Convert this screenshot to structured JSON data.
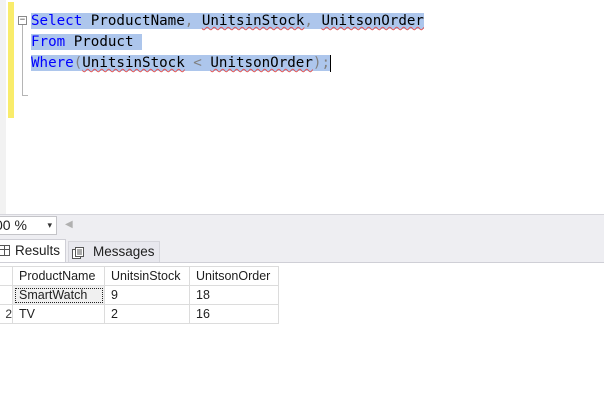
{
  "editor": {
    "lines": {
      "line1": {
        "kw_select": "Select",
        "sp1": " ",
        "col1": "ProductName",
        "comma1": ",",
        "sp2": " ",
        "col2": "UnitsinStock",
        "comma2": ",",
        "sp3": " ",
        "col3": "UnitsonOrder"
      },
      "line2": {
        "kw_from": "From",
        "sp1": " ",
        "table": "Product",
        "pad": " "
      },
      "line3": {
        "kw_where": "Where",
        "lparen": "(",
        "col_a": "UnitsinStock",
        "op": " < ",
        "col_b": "UnitsonOrder",
        "rparen": ")",
        "semi": ";"
      }
    },
    "collapse_glyph": "−"
  },
  "zoom": {
    "value": "00 %",
    "arrow": "▾",
    "scroll_left": "◀"
  },
  "tabs": {
    "results_label": "Results",
    "messages_label": "Messages"
  },
  "results": {
    "columns": [
      "ProductName",
      "UnitsinStock",
      "UnitsonOrder"
    ],
    "rows": [
      {
        "num": "",
        "cells": [
          "SmartWatch",
          "9",
          "18"
        ]
      },
      {
        "num": "2",
        "cells": [
          "TV",
          "2",
          "16"
        ]
      }
    ]
  },
  "colors": {
    "keyword": "#0000ff",
    "selection": "#adc6ec",
    "change_bar": "#f9ec6b",
    "squiggle": "#e05252"
  }
}
